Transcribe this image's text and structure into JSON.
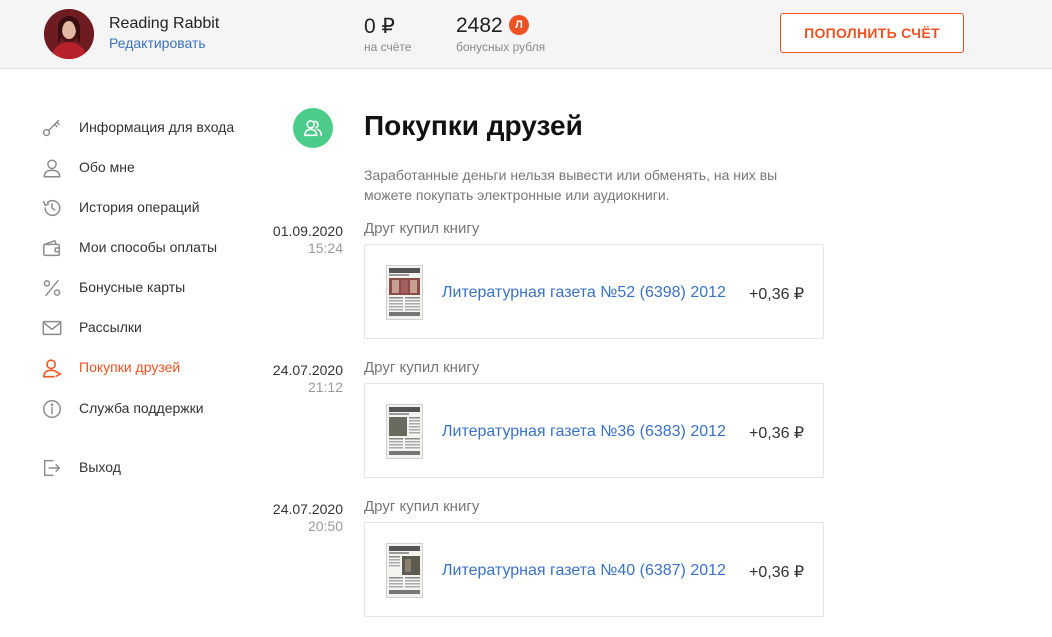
{
  "header": {
    "user_name": "Reading Rabbit",
    "edit_label": "Редактировать",
    "balance": {
      "amount": "0 ₽",
      "caption": "на счёте"
    },
    "bonus": {
      "amount": "2482",
      "badge": "Л",
      "caption": "бонусных рубля"
    },
    "topup_label": "ПОПОЛНИТЬ СЧЁТ"
  },
  "sidebar": {
    "items": [
      {
        "label": "Информация для входа",
        "icon": "key-icon",
        "active": false
      },
      {
        "label": "Обо мне",
        "icon": "user-icon",
        "active": false
      },
      {
        "label": "История операций",
        "icon": "history-icon",
        "active": false
      },
      {
        "label": "Мои способы оплаты",
        "icon": "wallet-icon",
        "active": false
      },
      {
        "label": "Бонусные карты",
        "icon": "percent-icon",
        "active": false
      },
      {
        "label": "Рассылки",
        "icon": "envelope-icon",
        "active": false
      },
      {
        "label": "Покупки друзей",
        "icon": "friend-icon",
        "active": true
      },
      {
        "label": "Служба поддержки",
        "icon": "info-icon",
        "active": false
      },
      {
        "label": "Выход",
        "icon": "logout-icon",
        "active": false
      }
    ]
  },
  "main": {
    "title": "Покупки друзей",
    "description": "Заработанные деньги нельзя вывести или обменять, на них вы можете покупать электронные или аудиокниги.",
    "operations": [
      {
        "date": "01.09.2020",
        "time": "15:24",
        "heading": "Друг купил книгу",
        "book": "Литературная газета №52 (6398) 2012",
        "amount": "+0,36 ₽"
      },
      {
        "date": "24.07.2020",
        "time": "21:12",
        "heading": "Друг купил книгу",
        "book": "Литературная газета №36 (6383) 2012",
        "amount": "+0,36 ₽"
      },
      {
        "date": "24.07.2020",
        "time": "20:50",
        "heading": "Друг купил книгу",
        "book": "Литературная газета №40 (6387) 2012",
        "amount": "+0,36 ₽"
      }
    ]
  },
  "colors": {
    "accent": "#ee5222",
    "link": "#3972c4",
    "page_icon_bg": "#4ccc8a"
  }
}
